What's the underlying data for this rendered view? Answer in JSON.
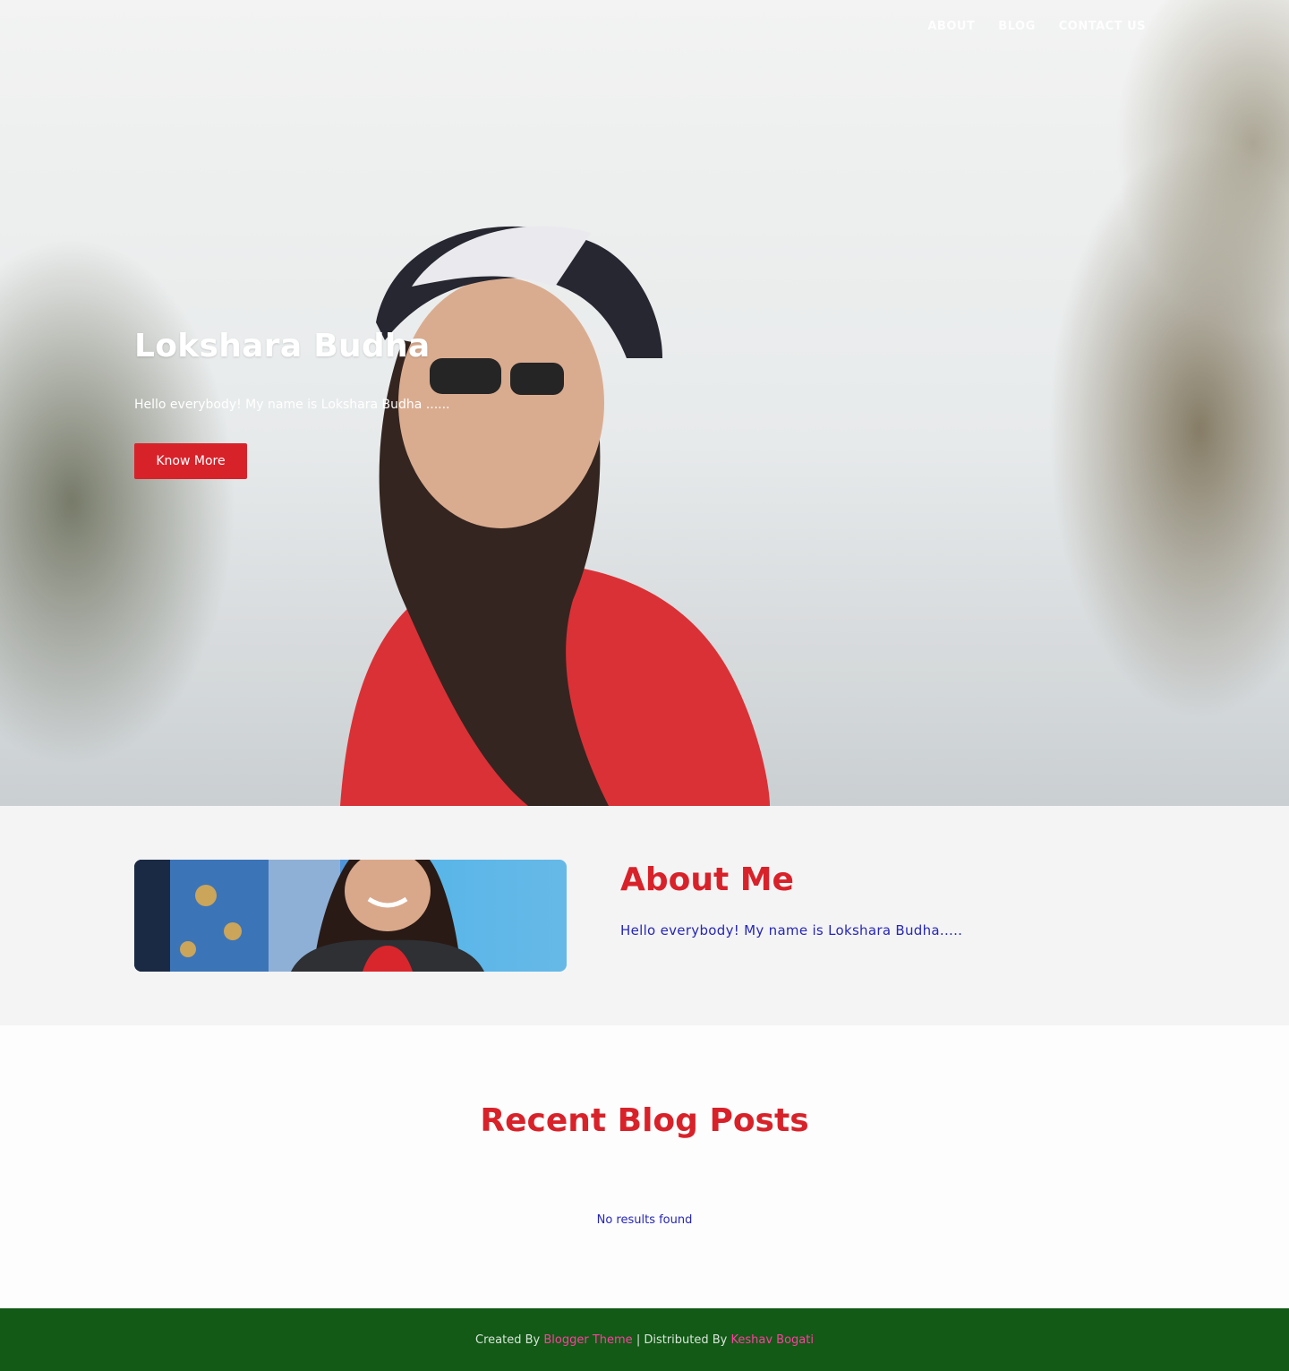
{
  "nav": {
    "items": [
      "About",
      "Blog",
      "Contact Us"
    ]
  },
  "hero": {
    "title": "Lokshara Budha",
    "text": "Hello everybody! My name is Lokshara Budha ......",
    "button_label": "Know More"
  },
  "about": {
    "title": "About Me",
    "text": "Hello everybody! My name is Lokshara Budha....."
  },
  "blog": {
    "title": "Recent Blog Posts",
    "empty_message": "No results found"
  },
  "footer": {
    "created_by_text": "Created By",
    "theme_link": "Blogger Theme",
    "distributed_text": "| Distributed By",
    "author_link": "Keshav Bogati"
  },
  "colors": {
    "accent": "#d8222a",
    "link_blue": "#2626b8",
    "footer_bg": "#125a16",
    "footer_link": "#ff3fa0"
  }
}
